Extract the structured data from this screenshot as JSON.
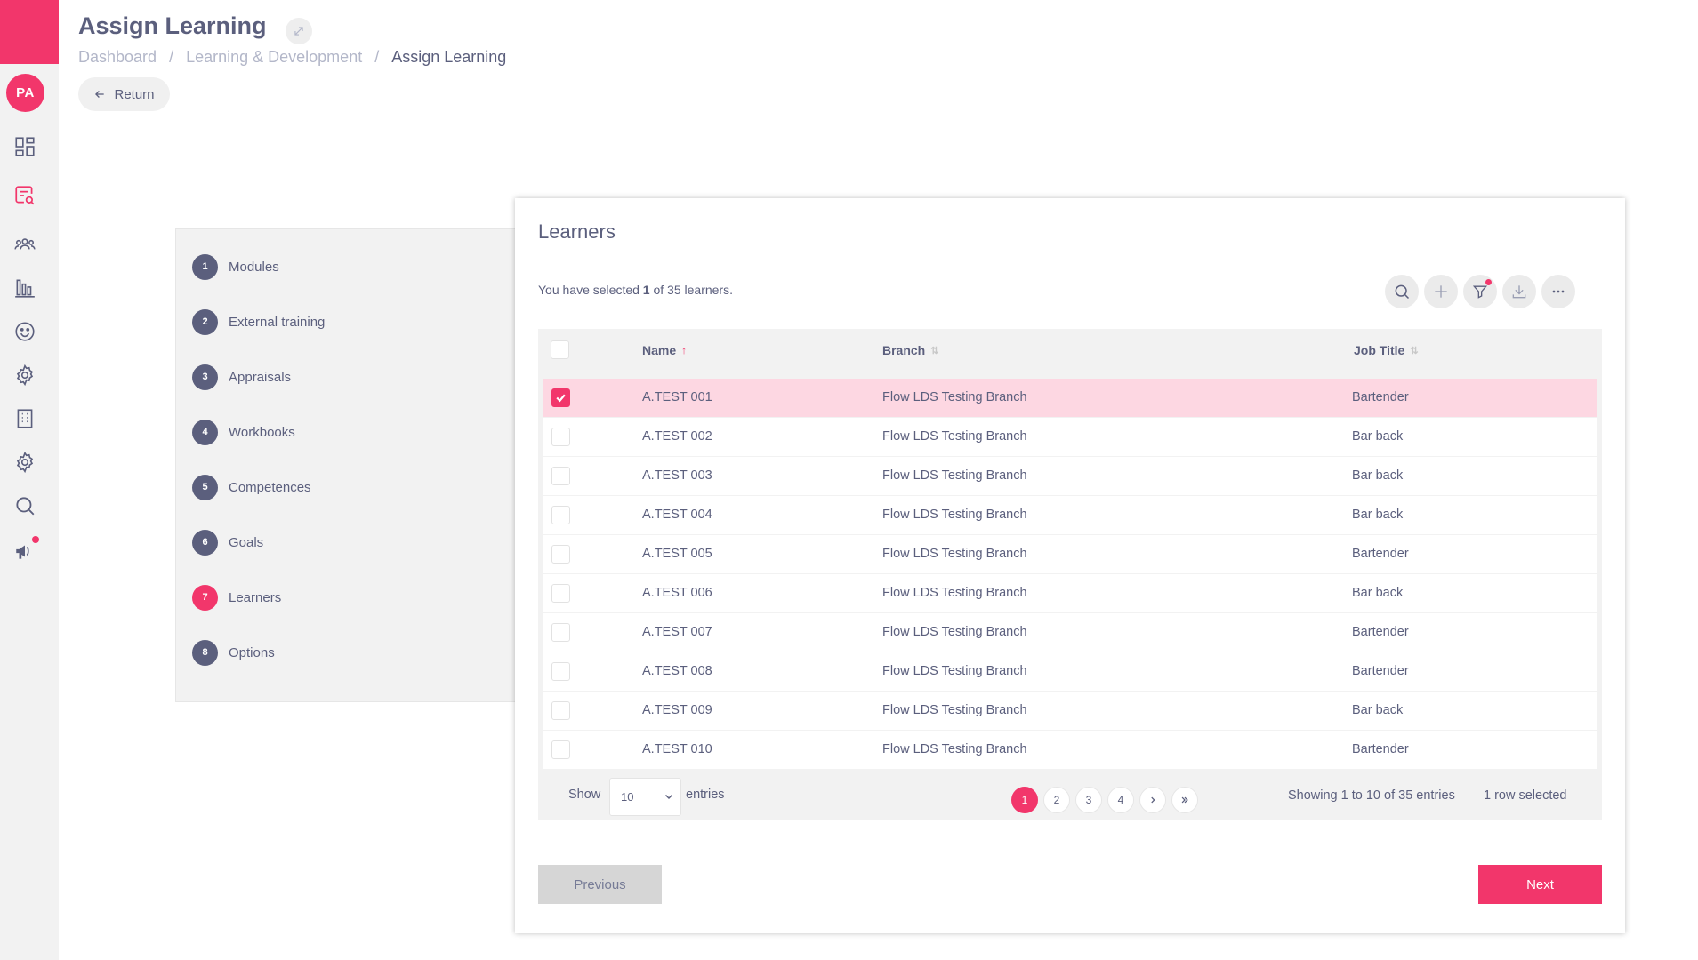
{
  "sidebar": {
    "avatar_initials": "PA",
    "icons": [
      "dashboard-icon",
      "learning-search-icon",
      "people-icon",
      "chart-icon",
      "smiley-icon",
      "settings-icon",
      "building-icon",
      "settings-alt-icon",
      "search-icon",
      "megaphone-icon"
    ]
  },
  "header": {
    "title": "Assign Learning",
    "breadcrumb": [
      "Dashboard",
      "Learning & Development",
      "Assign Learning"
    ],
    "separator": "/",
    "return_label": "Return"
  },
  "steps": [
    {
      "num": "1",
      "label": "Modules"
    },
    {
      "num": "2",
      "label": "External training"
    },
    {
      "num": "3",
      "label": "Appraisals"
    },
    {
      "num": "4",
      "label": "Workbooks"
    },
    {
      "num": "5",
      "label": "Competences"
    },
    {
      "num": "6",
      "label": "Goals"
    },
    {
      "num": "7",
      "label": "Learners",
      "active": true
    },
    {
      "num": "8",
      "label": "Options"
    }
  ],
  "learners": {
    "title": "Learners",
    "selected_prefix": "You have selected ",
    "selected_count": "1",
    "selected_suffix": " of 35 learners.",
    "columns": {
      "name": "Name",
      "branch": "Branch",
      "job_title": "Job Title"
    },
    "rows": [
      {
        "name": "A.TEST 001",
        "branch": "Flow LDS Testing Branch",
        "job_title": "Bartender",
        "selected": true
      },
      {
        "name": "A.TEST 002",
        "branch": "Flow LDS Testing Branch",
        "job_title": "Bar back",
        "selected": false
      },
      {
        "name": "A.TEST 003",
        "branch": "Flow LDS Testing Branch",
        "job_title": "Bar back",
        "selected": false
      },
      {
        "name": "A.TEST 004",
        "branch": "Flow LDS Testing Branch",
        "job_title": "Bar back",
        "selected": false
      },
      {
        "name": "A.TEST 005",
        "branch": "Flow LDS Testing Branch",
        "job_title": "Bartender",
        "selected": false
      },
      {
        "name": "A.TEST 006",
        "branch": "Flow LDS Testing Branch",
        "job_title": "Bar back",
        "selected": false
      },
      {
        "name": "A.TEST 007",
        "branch": "Flow LDS Testing Branch",
        "job_title": "Bartender",
        "selected": false
      },
      {
        "name": "A.TEST 008",
        "branch": "Flow LDS Testing Branch",
        "job_title": "Bartender",
        "selected": false
      },
      {
        "name": "A.TEST 009",
        "branch": "Flow LDS Testing Branch",
        "job_title": "Bar back",
        "selected": false
      },
      {
        "name": "A.TEST 010",
        "branch": "Flow LDS Testing Branch",
        "job_title": "Bartender",
        "selected": false
      }
    ],
    "footer": {
      "show_label": "Show",
      "page_size": "10",
      "entries_label": "entries",
      "pages": [
        "1",
        "2",
        "3",
        "4"
      ],
      "current_page": "1",
      "showing_text": "Showing 1 to 10 of 35 entries",
      "row_selected_text": "1 row selected"
    },
    "previous_label": "Previous",
    "next_label": "Next"
  },
  "colors": {
    "accent": "#f2366b",
    "text": "#5b5f7d",
    "muted": "#b3b7c9",
    "selected_row": "#fdd7e2"
  }
}
